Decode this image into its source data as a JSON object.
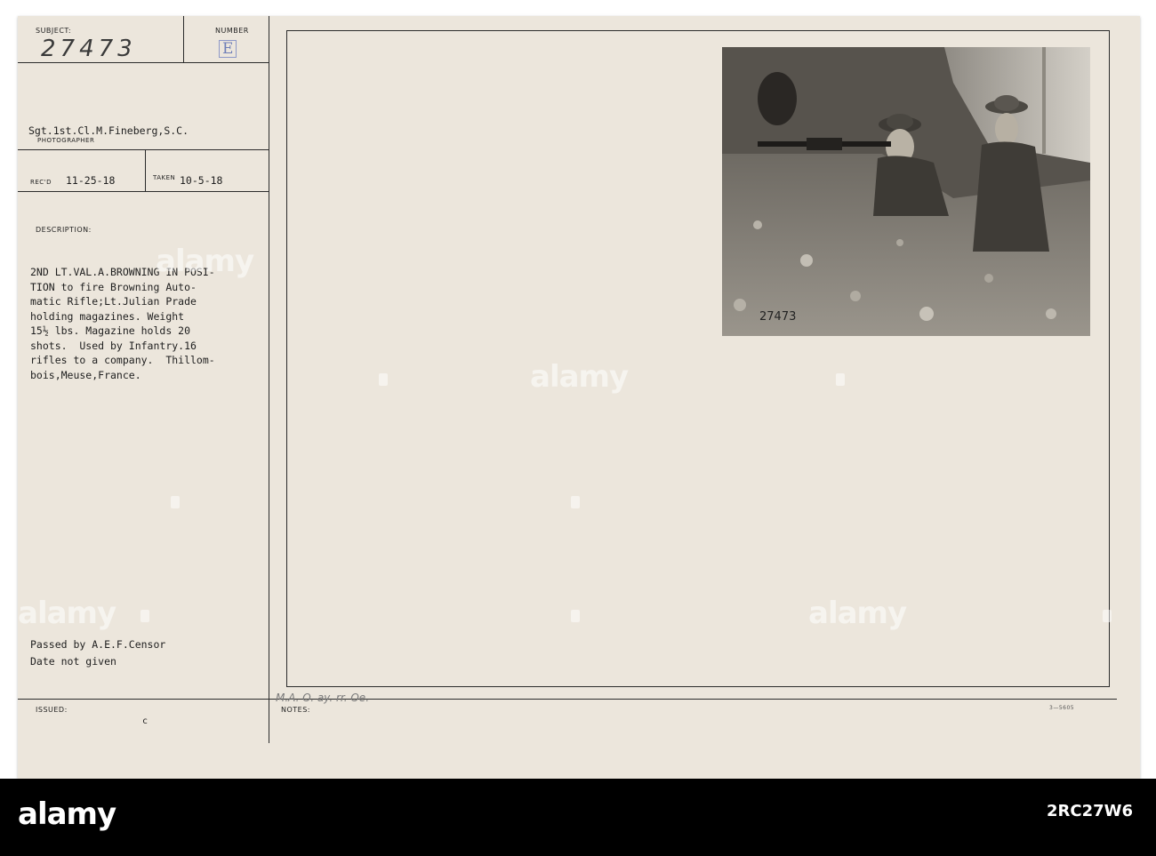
{
  "card": {
    "subject_label": "SUBJECT:",
    "subject_value": "27473",
    "number_label": "NUMBER",
    "number_value": "E",
    "photographer_name": "Sgt.1st.Cl.M.Fineberg,S.C.",
    "photographer_label": "PHOTOGRAPHER",
    "recd_label": "REC'D",
    "recd_value": "11-25-18",
    "taken_label": "TAKEN",
    "taken_value": "10-5-18",
    "description_label": "DESCRIPTION:",
    "description_text": "2ND LT.VAL.A.BROWNING IN POSI-\nTION to fire Browning Auto-\nmatic Rifle;Lt.Julian Prade\nholding magazines. Weight\n15½ lbs. Magazine holds 20\nshots.  Used by Infantry.16\nrifles to a company.  Thillom-\nbois,Meuse,France.",
    "censor_text": "Passed by A.E.F.Censor\nDate not given",
    "issued_label": "ISSUED:",
    "issued_value": "c",
    "notes_label": "NOTES:",
    "notes_value": "M.A. O. ay. rr. Oe.",
    "corner_code": "3—5605",
    "photo_number": "27473"
  },
  "watermark": {
    "text": "alamy"
  },
  "footer": {
    "brand": "alamy",
    "image_id": "2RC27W6"
  }
}
